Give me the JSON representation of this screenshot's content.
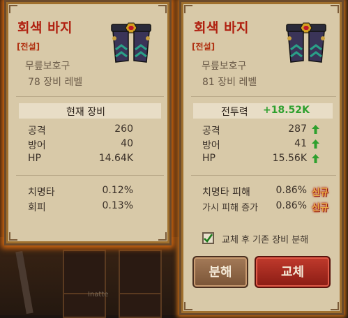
{
  "left": {
    "title": "회색 바지",
    "grade": "[전설]",
    "type": "무릎보호구",
    "level": "78 장비 레벨",
    "header": "현재 장비",
    "stats": [
      {
        "label": "공격",
        "value": "260"
      },
      {
        "label": "방어",
        "value": "40"
      },
      {
        "label": "HP",
        "value": "14.64K"
      }
    ],
    "extra": [
      {
        "label": "치명타",
        "value": "0.12%"
      },
      {
        "label": "회피",
        "value": "0.13%"
      }
    ]
  },
  "right": {
    "title": "회색 바지",
    "grade": "[전설]",
    "type": "무릎보호구",
    "level": "81 장비 레벨",
    "power_label": "전투력",
    "power_value": "+18.52K",
    "stats": [
      {
        "label": "공격",
        "value": "287"
      },
      {
        "label": "방어",
        "value": "41"
      },
      {
        "label": "HP",
        "value": "15.56K"
      }
    ],
    "extra": [
      {
        "label": "치명타 피해",
        "value": "0.86%",
        "badge": "신규"
      },
      {
        "label": "가시 피해 증가",
        "value": "0.86%",
        "badge": "신규"
      }
    ],
    "checkbox_label": "교체 후 기존 장비 분해",
    "checkbox_checked": true,
    "disassemble_label": "분해",
    "equip_label": "교체"
  },
  "background": {
    "slot_caption": "Inatte"
  },
  "colors": {
    "title": "#b02010",
    "power_positive": "#2ea02e",
    "badge": "#e8b048",
    "equip_button": "#b02a20",
    "disassemble_button": "#8f6444"
  },
  "icons": [
    "pants-item-icon",
    "arrow-up-icon",
    "check-icon"
  ]
}
